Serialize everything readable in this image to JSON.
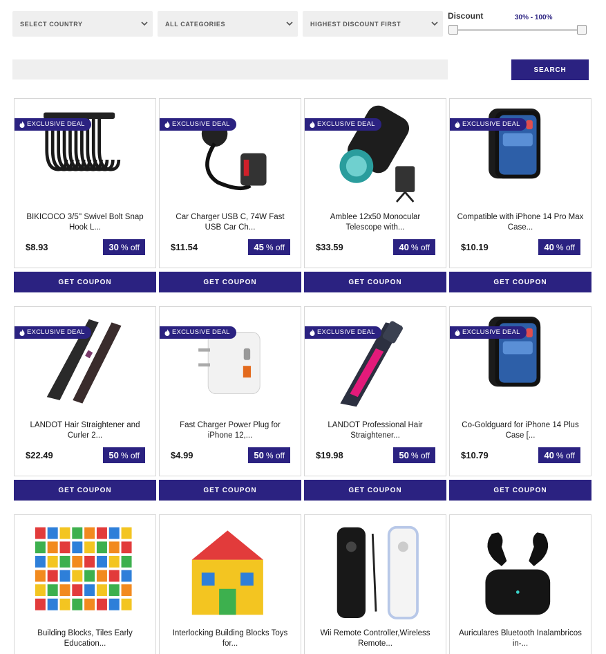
{
  "filters": {
    "country": "SELECT COUNTRY",
    "category": "ALL CATEGORIES",
    "sort": "HIGHEST DISCOUNT FIRST"
  },
  "discount": {
    "title": "Discount",
    "range_text": "30% - 100%",
    "min": 30,
    "max": 100
  },
  "search": {
    "placeholder": "",
    "button_label": "SEARCH"
  },
  "badge_label": "EXCLUSIVE DEAL",
  "coupon_label": "GET COUPON",
  "off_suffix": "% off",
  "products": [
    {
      "name": "BIKICOCO 3/5'' Swivel Bolt Snap Hook L...",
      "price": "$8.93",
      "discount": "30",
      "exclusive": true,
      "icon": "snap-hooks-image"
    },
    {
      "name": "Car Charger USB C, 74W Fast USB Car Ch...",
      "price": "$11.54",
      "discount": "45",
      "exclusive": true,
      "icon": "car-charger-image"
    },
    {
      "name": "Amblee 12x50 Monocular Telescope with...",
      "price": "$33.59",
      "discount": "40",
      "exclusive": true,
      "icon": "monocular-image"
    },
    {
      "name": "Compatible with iPhone 14 Pro Max Case...",
      "price": "$10.19",
      "discount": "40",
      "exclusive": true,
      "icon": "phone-case-image"
    },
    {
      "name": "LANDOT Hair Straightener and Curler 2...",
      "price": "$22.49",
      "discount": "50",
      "exclusive": true,
      "icon": "hair-straightener-image"
    },
    {
      "name": "Fast Charger Power Plug for iPhone 12,...",
      "price": "$4.99",
      "discount": "50",
      "exclusive": true,
      "icon": "power-plug-image"
    },
    {
      "name": "LANDOT Professional Hair Straightener...",
      "price": "$19.98",
      "discount": "50",
      "exclusive": true,
      "icon": "flat-iron-image"
    },
    {
      "name": "Co-Goldguard for iPhone 14 Plus Case [...",
      "price": "$10.79",
      "discount": "40",
      "exclusive": true,
      "icon": "phone-case-image"
    },
    {
      "name": "Building Blocks, Tiles Early Education...",
      "price": "",
      "discount": "",
      "exclusive": false,
      "icon": "building-tiles-image"
    },
    {
      "name": "Interlocking Building Blocks Toys for...",
      "price": "",
      "discount": "",
      "exclusive": false,
      "icon": "block-house-image"
    },
    {
      "name": "Wii Remote Controller,Wireless Remote...",
      "price": "",
      "discount": "",
      "exclusive": false,
      "icon": "wii-remote-image"
    },
    {
      "name": "Auriculares Bluetooth Inalambricos in-...",
      "price": "",
      "discount": "",
      "exclusive": false,
      "icon": "earbuds-image"
    }
  ]
}
